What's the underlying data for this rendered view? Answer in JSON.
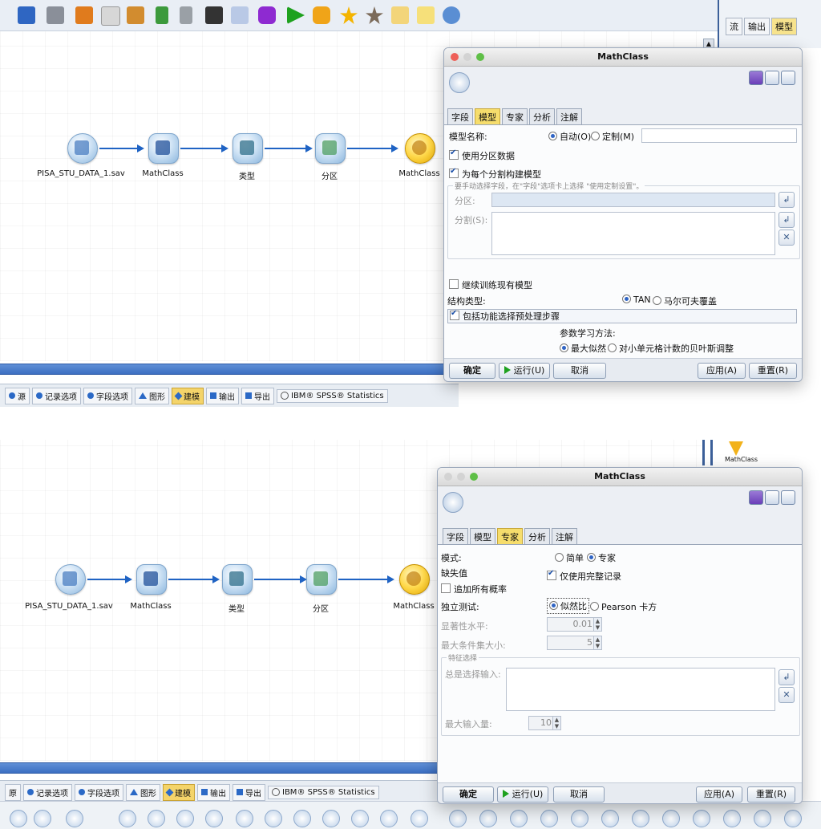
{
  "right_panel": {
    "tabs": [
      "流",
      "输出",
      "模型"
    ],
    "model_name": "MathClass"
  },
  "canvas": {
    "nodes": [
      {
        "label": "PISA_STU_DATA_1.sav",
        "icon": "file-source-icon"
      },
      {
        "label": "MathClass",
        "icon": "derive-icon"
      },
      {
        "label": "类型",
        "icon": "type-icon"
      },
      {
        "label": "分区",
        "icon": "partition-icon"
      },
      {
        "label": "MathClass",
        "icon": "bayes-net-model-icon"
      }
    ]
  },
  "palette": {
    "top": {
      "first_tab": "源"
    },
    "bottom": {
      "first_tab": "原"
    },
    "tabs": [
      "记录选项",
      "字段选项",
      "图形",
      "建模",
      "输出",
      "导出",
      "IBM® SPSS® Statistics"
    ],
    "active_tab": "建模"
  },
  "dialog": {
    "title": "MathClass",
    "tabs": [
      "字段",
      "模型",
      "专家",
      "分析",
      "注解"
    ],
    "ok": "确定",
    "run": "运行(U)",
    "cancel": "取消",
    "apply": "应用(A)",
    "reset": "重置(R)"
  },
  "model_tab": {
    "model_name_label": "模型名称:",
    "auto": "自动(O)",
    "custom": "定制(M)",
    "use_partition": "使用分区数据",
    "build_per_split": "为每个分割构建模型",
    "group_title": "要手动选择字段，在\"字段\"选项卡上选择 \"使用定制设置\"。",
    "partition_label": "分区:",
    "split_label": "分割(S):",
    "continue_training": "继续训练现有模型",
    "structure_label": "结构类型:",
    "tan": "TAN",
    "markov": "马尔可夫覆盖",
    "feature_preprocess": "包括功能选择预处理步骤",
    "param_label": "参数学习方法:",
    "max_likelihood": "最大似然",
    "bayes_adjust": "对小单元格计数的贝叶斯调整"
  },
  "expert_tab": {
    "mode_label": "模式:",
    "simple": "简单",
    "expert": "专家",
    "missing_label": "缺失值",
    "complete_only": "仅使用完整记录",
    "append_probs": "追加所有概率",
    "independence_label": "独立测试:",
    "likelihood_ratio": "似然比",
    "pearson": "Pearson 卡方",
    "significance_label": "显著性水平:",
    "significance_value": "0.01",
    "max_cond_label": "最大条件集大小:",
    "max_cond_value": "5",
    "feature_group": "特征选择",
    "always_inputs": "总是选择输入:",
    "max_inputs_label": "最大输入量:",
    "max_inputs_value": "10"
  },
  "colors": {
    "accent_blue": "#1f63c4",
    "active_tab": "#f6dd6c",
    "splitter": "#3c6fc2"
  }
}
